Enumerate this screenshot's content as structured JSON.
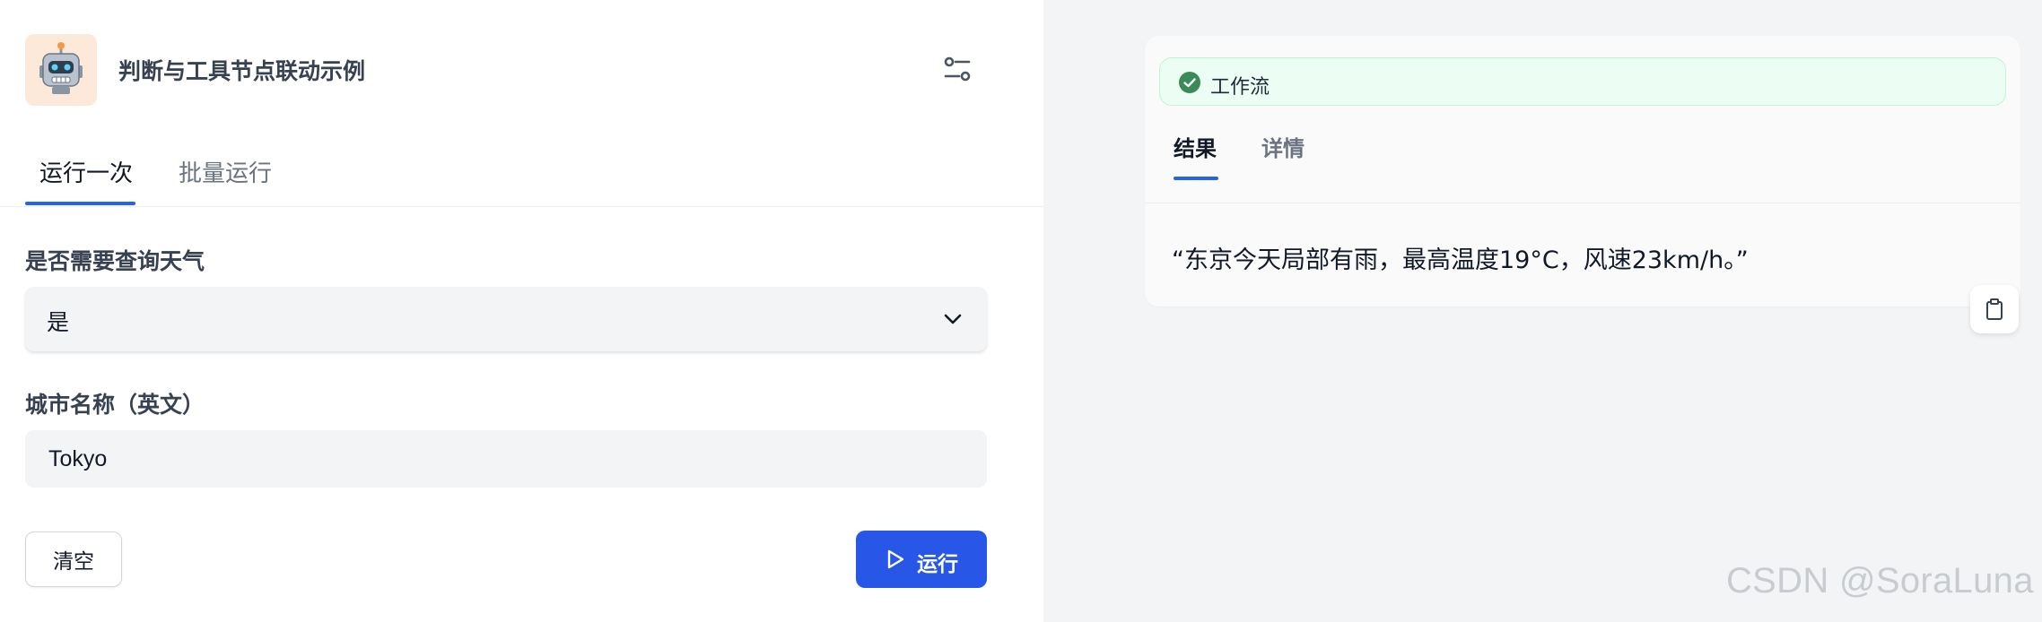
{
  "app": {
    "title": "判断与工具节点联动示例",
    "icon": "robot-emoji",
    "icon_bg_color": "#fde9d9"
  },
  "tabs": [
    {
      "label": "运行一次",
      "active": true
    },
    {
      "label": "批量运行",
      "active": false
    }
  ],
  "form": {
    "weather_field": {
      "label": "是否需要查询天气",
      "selected_value": "是"
    },
    "city_field": {
      "label": "城市名称（英文）",
      "value": "Tokyo"
    }
  },
  "actions": {
    "clear_label": "清空",
    "run_label": "运行"
  },
  "result": {
    "status_label": "工作流",
    "status": "success",
    "tabs": [
      {
        "label": "结果",
        "active": true
      },
      {
        "label": "详情",
        "active": false
      }
    ],
    "output_text": "“东京今天局部有雨，最高温度19°C，风速23km/h。”"
  },
  "watermark": "CSDN @SoraLuna",
  "colors": {
    "accent": "#2563eb",
    "run_button": "#2857e8",
    "success": "#3a8a5a",
    "success_bg": "#ecfdf3",
    "right_panel_bg": "#f3f4f6"
  }
}
